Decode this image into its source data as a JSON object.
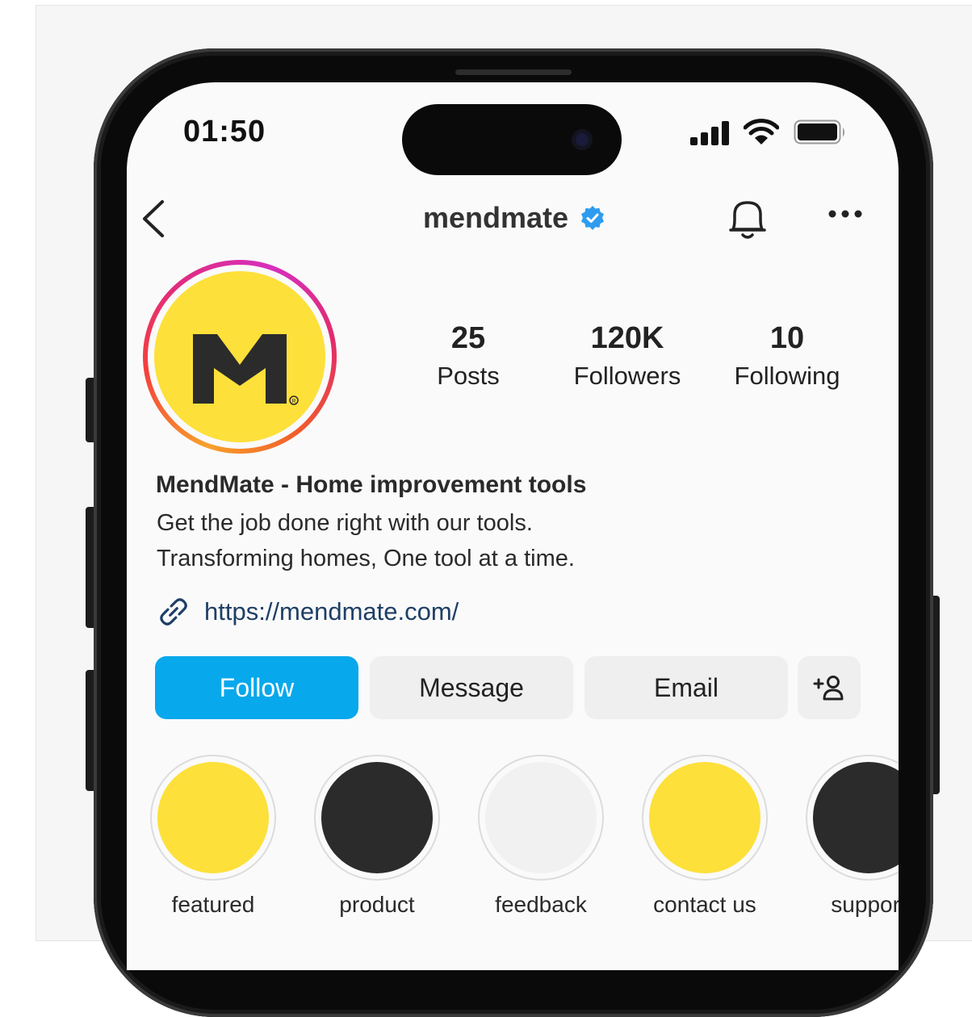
{
  "status_bar": {
    "time": "01:50"
  },
  "header": {
    "username": "mendmate",
    "verified": true,
    "back_icon": "chevron-left-icon",
    "bell_icon": "bell-icon",
    "more_icon": "more-horizontal-icon"
  },
  "profile": {
    "avatar_color": "#fde03a",
    "stats": [
      {
        "value": "25",
        "label": "Posts"
      },
      {
        "value": "120K",
        "label": "Followers"
      },
      {
        "value": "10",
        "label": "Following"
      }
    ],
    "name": "MendMate - Home improvement tools",
    "bio_lines": [
      "Get the job done right with our tools.",
      "Transforming homes, One tool at a time."
    ],
    "link": "https://mendmate.com/"
  },
  "actions": {
    "follow": "Follow",
    "message": "Message",
    "email": "Email",
    "add_user_icon": "add-person-icon"
  },
  "highlights": [
    {
      "label": "featured",
      "color": "#fde03a"
    },
    {
      "label": "product",
      "color": "#2b2b2b"
    },
    {
      "label": "feedback",
      "color": "#f1f1f1"
    },
    {
      "label": "contact us",
      "color": "#fde03a"
    },
    {
      "label": "support",
      "color": "#2b2b2b"
    }
  ],
  "colors": {
    "accent_blue": "#08a8ec",
    "verified_blue": "#2d9cf0",
    "link": "#1e3f66"
  }
}
